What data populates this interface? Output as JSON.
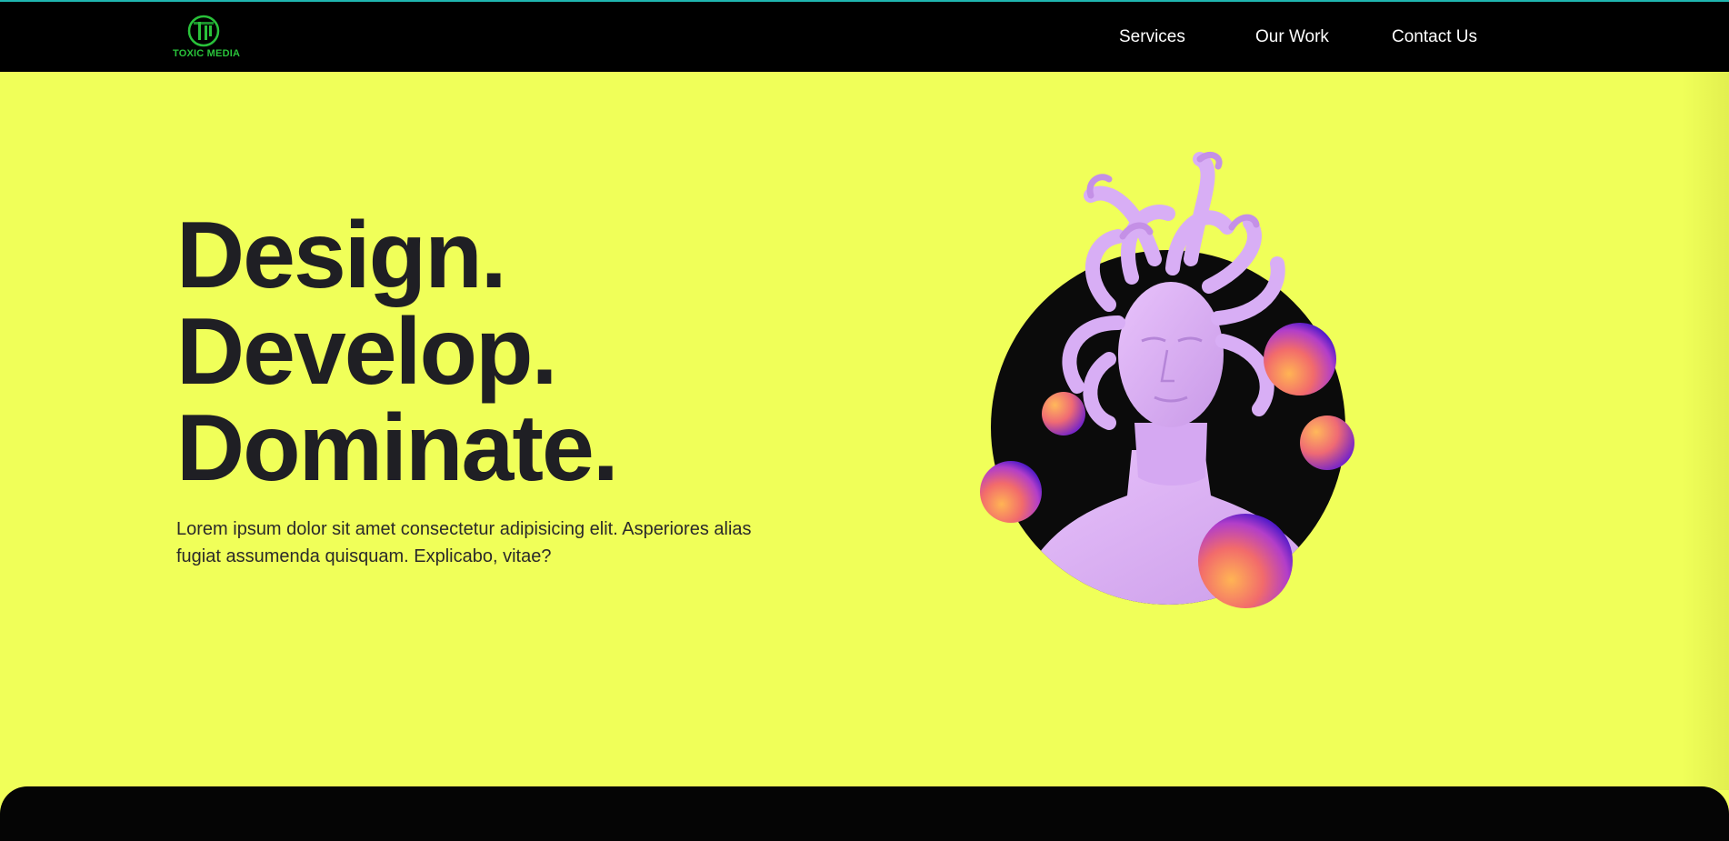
{
  "brand": {
    "logo_text": "TOXIC MEDIA",
    "logo_icon": "tm-monogram-icon",
    "logo_color": "#29c23a"
  },
  "nav": {
    "items": [
      {
        "label": "Services"
      },
      {
        "label": "Our Work"
      },
      {
        "label": "Contact Us"
      }
    ]
  },
  "hero": {
    "title_lines": [
      "Design.",
      "Develop.",
      "Dominate."
    ],
    "subtitle": "Lorem ipsum dolor sit amet consectetur adipisicing elit. Asperiores alias fugiat assumenda quisquam. Explicabo, vitae?",
    "image": "medusa-bust-illustration"
  },
  "colors": {
    "background": "#f0ff59",
    "navbar": "#000000",
    "accent_line": "#1fb6b0",
    "heading": "#1f1f24",
    "bust": "#dcaaf6"
  }
}
